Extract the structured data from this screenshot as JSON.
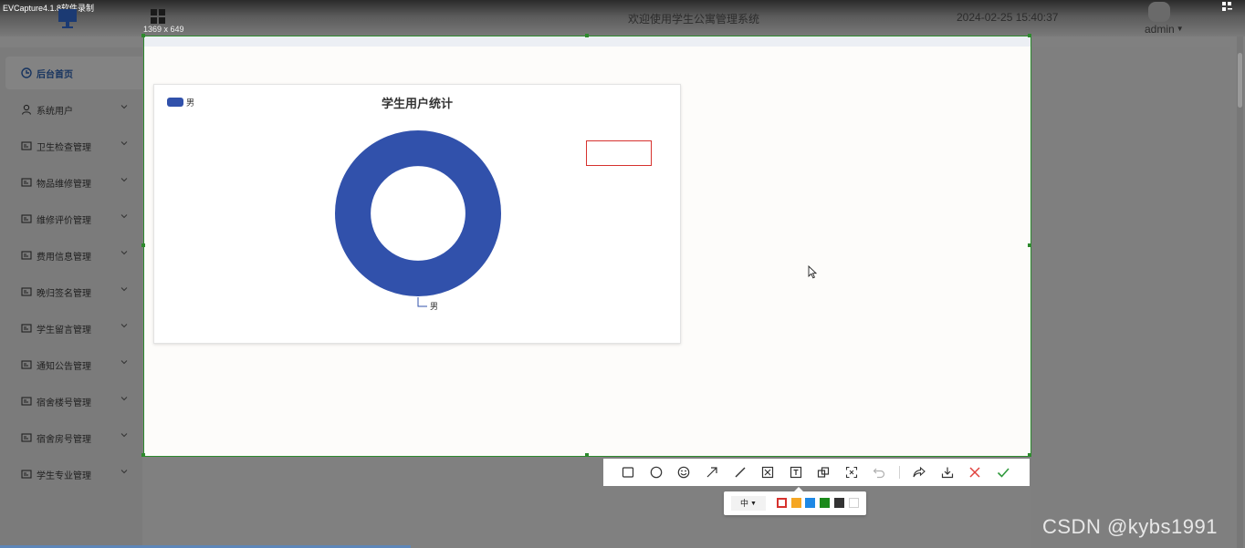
{
  "capture_app": {
    "title": "EVCapture4.1.8软件录制",
    "selection_size": "1369 x 649"
  },
  "header": {
    "welcome": "欢迎使用学生公寓管理系统",
    "datetime": "2024-02-25 15:40:37",
    "user": "admin"
  },
  "sidebar": {
    "items": [
      {
        "label": "后台首页",
        "icon": "clock-icon",
        "active": true
      },
      {
        "label": "系统用户",
        "icon": "user-icon"
      },
      {
        "label": "卫生检查管理",
        "icon": "card-icon"
      },
      {
        "label": "物品维修管理",
        "icon": "card-icon"
      },
      {
        "label": "维修评价管理",
        "icon": "card-icon"
      },
      {
        "label": "费用信息管理",
        "icon": "card-icon"
      },
      {
        "label": "晚归签名管理",
        "icon": "card-icon"
      },
      {
        "label": "学生留言管理",
        "icon": "card-icon"
      },
      {
        "label": "通知公告管理",
        "icon": "card-icon"
      },
      {
        "label": "宿舍楼号管理",
        "icon": "card-icon"
      },
      {
        "label": "宿舍房号管理",
        "icon": "card-icon"
      },
      {
        "label": "学生专业管理",
        "icon": "card-icon"
      }
    ]
  },
  "chart_data": {
    "type": "pie",
    "title": "学生用户统计",
    "legend": {
      "placement": "top-left",
      "entries": [
        "男"
      ]
    },
    "slices": [
      {
        "name": "男",
        "value": 1,
        "color": "#3151ab"
      }
    ],
    "inner_radius_ratio": 0.57
  },
  "toolbar": {
    "tools": [
      "rectangle-icon",
      "ellipse-icon",
      "emoji-icon",
      "arrow-icon",
      "line-icon",
      "mosaic-icon",
      "text-icon",
      "copy-icon",
      "ocr-icon",
      "undo-icon",
      "share-icon",
      "download-icon",
      "cancel-icon",
      "confirm-icon"
    ],
    "size_label": "中",
    "colors": [
      "#d6322e",
      "#f5a623",
      "#1e88e5",
      "#1b8a1b",
      "#333333",
      "#ffffff"
    ],
    "selected_color": "#d6322e"
  },
  "watermark": "CSDN @kybs1991"
}
